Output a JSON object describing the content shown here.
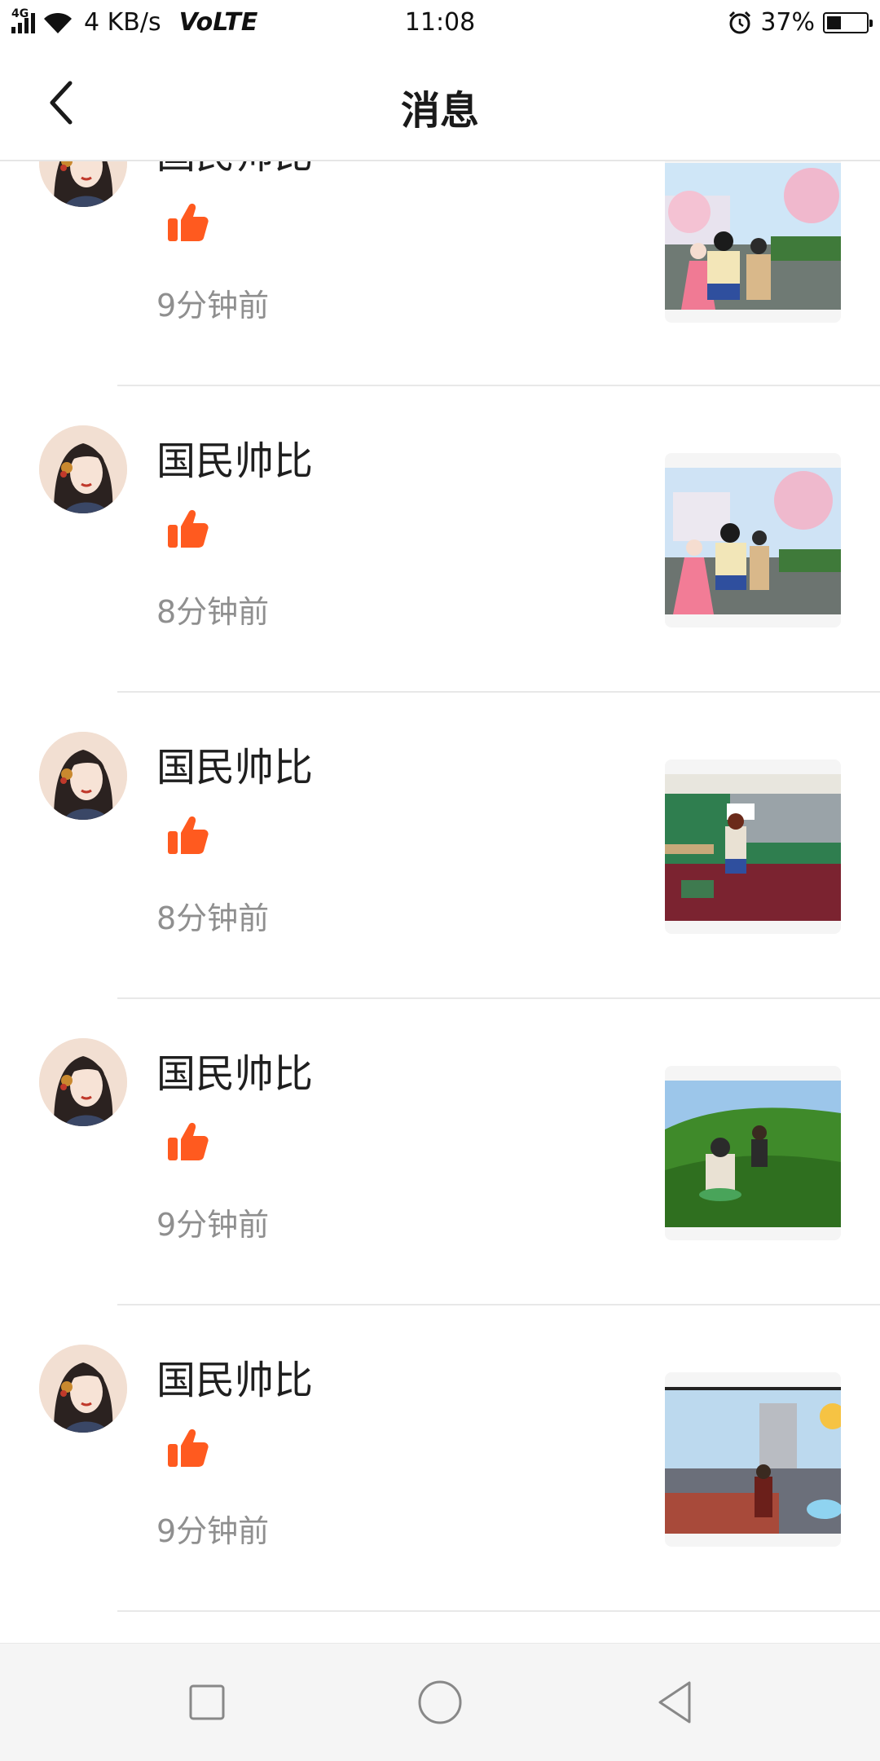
{
  "status_bar": {
    "network": "4G",
    "speed": "4 KB/s",
    "volte": "VoLTE",
    "time": "11:08",
    "battery": "37%",
    "battery_level": 0.37
  },
  "header": {
    "title": "消息",
    "back_icon": "chevron-left-icon"
  },
  "notifications": [
    {
      "user": "国民帅比",
      "time": "9分钟前",
      "icon": "thumbs-up-icon"
    },
    {
      "user": "国民帅比",
      "time": "8分钟前",
      "icon": "thumbs-up-icon"
    },
    {
      "user": "国民帅比",
      "time": "8分钟前",
      "icon": "thumbs-up-icon"
    },
    {
      "user": "国民帅比",
      "time": "9分钟前",
      "icon": "thumbs-up-icon"
    },
    {
      "user": "国民帅比",
      "time": "9分钟前",
      "icon": "thumbs-up-icon"
    }
  ],
  "nav_bar": {
    "recent_icon": "square-icon",
    "home_icon": "circle-icon",
    "back_icon": "triangle-back-icon"
  },
  "colors": {
    "like": "#ff5a1f",
    "time_text": "#8f8f8f",
    "divider": "#e8e8e8"
  }
}
